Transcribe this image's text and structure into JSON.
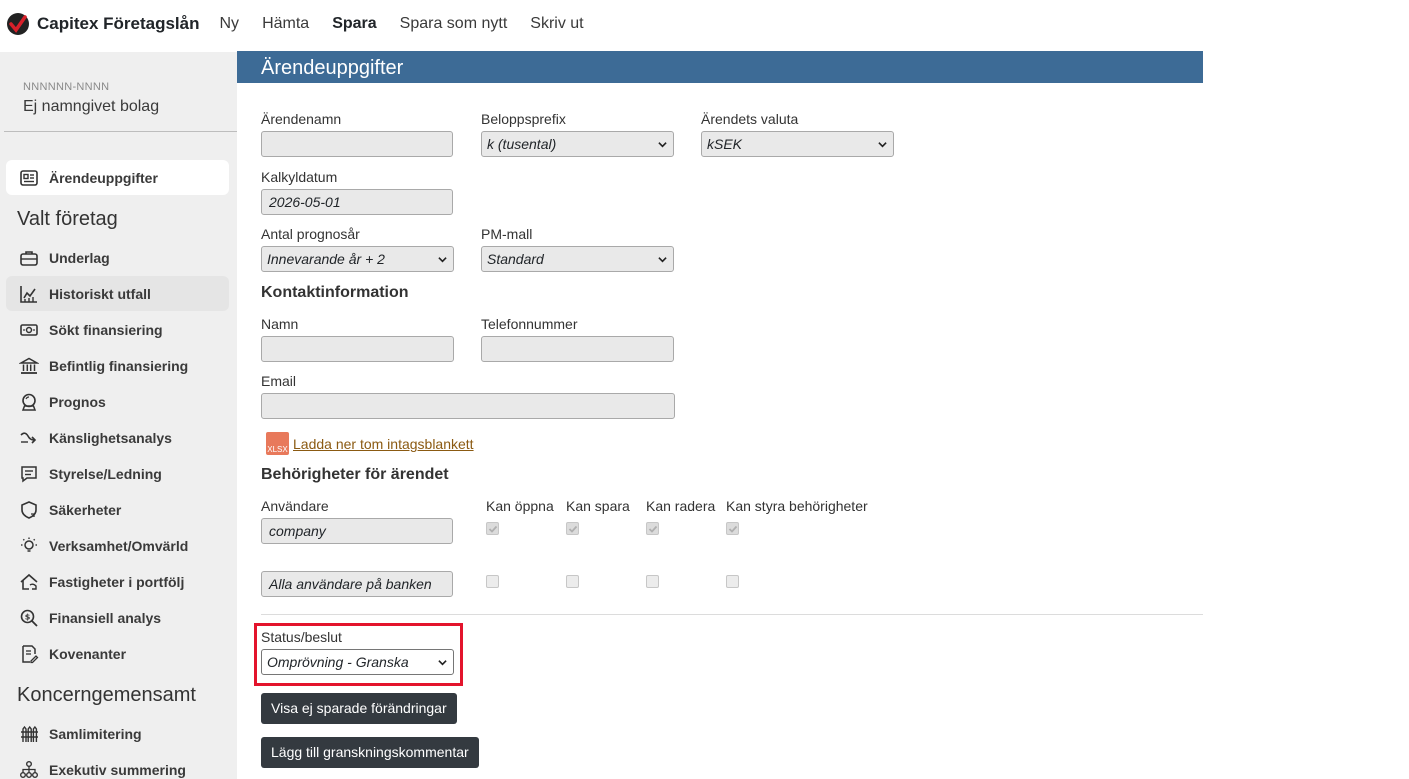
{
  "app": {
    "brand": "Capitex Företagslån",
    "nav": [
      {
        "label": "Ny",
        "bold": false
      },
      {
        "label": "Hämta",
        "bold": false
      },
      {
        "label": "Spara",
        "bold": true
      },
      {
        "label": "Spara som nytt",
        "bold": false
      },
      {
        "label": "Skriv ut",
        "bold": false
      }
    ]
  },
  "sidebar": {
    "org_nr": "NNNNNN-NNNN",
    "company_name": "Ej namngivet bolag",
    "top_item": {
      "label": "Ärendeuppgifter",
      "icon": "id-card-icon",
      "active": true
    },
    "section_valt": "Valt företag",
    "items": [
      {
        "label": "Underlag",
        "icon": "briefcase-icon"
      },
      {
        "label": "Historiskt utfall",
        "icon": "chart-icon"
      },
      {
        "label": "Sökt finansiering",
        "icon": "cash-icon"
      },
      {
        "label": "Befintlig finansiering",
        "icon": "bank-icon"
      },
      {
        "label": "Prognos",
        "icon": "crystal-ball-icon"
      },
      {
        "label": "Känslighetsanalys",
        "icon": "arrow-curve-icon"
      },
      {
        "label": "Styrelse/Ledning",
        "icon": "chat-list-icon"
      },
      {
        "label": "Säkerheter",
        "icon": "shield-icon"
      },
      {
        "label": "Verksamhet/Omvärld",
        "icon": "lightbulb-icon"
      },
      {
        "label": "Fastigheter i portfölj",
        "icon": "house-icon"
      },
      {
        "label": "Finansiell analys",
        "icon": "search-dollar-icon"
      },
      {
        "label": "Kovenanter",
        "icon": "document-edit-icon"
      }
    ],
    "section_koncern": "Koncerngemensamt",
    "koncern_items": [
      {
        "label": "Samlimitering",
        "icon": "fence-icon"
      },
      {
        "label": "Exekutiv summering",
        "icon": "hierarchy-icon"
      }
    ]
  },
  "main": {
    "title": "Ärendeuppgifter",
    "fields": {
      "arendenamn_label": "Ärendenamn",
      "arendenamn_value": "",
      "beloppsprefix_label": "Beloppsprefix",
      "beloppsprefix_value": "k (tusental)",
      "valuta_label": "Ärendets valuta",
      "valuta_value": "kSEK",
      "kalkyldatum_label": "Kalkyldatum",
      "kalkyldatum_value": "2026-05-01",
      "prognosar_label": "Antal prognosår",
      "prognosar_value": "Innevarande år + 2",
      "pmmall_label": "PM-mall",
      "pmmall_value": "Standard"
    },
    "contact": {
      "title": "Kontaktinformation",
      "namn_label": "Namn",
      "namn_value": "",
      "telefon_label": "Telefonnummer",
      "telefon_value": "",
      "email_label": "Email",
      "email_value": ""
    },
    "download": {
      "icon_text": "XLSX",
      "link": "Ladda ner tom intagsblankett"
    },
    "permissions": {
      "title": "Behörigheter för ärendet",
      "headers": [
        "Användare",
        "Kan öppna",
        "Kan spara",
        "Kan radera",
        "Kan styra behörigheter"
      ],
      "rows": [
        {
          "user": "company",
          "checks": [
            true,
            true,
            true,
            true
          ]
        },
        {
          "user": "Alla användare på banken",
          "checks": [
            false,
            false,
            false,
            false
          ]
        }
      ]
    },
    "status": {
      "label": "Status/beslut",
      "value": "Omprövning - Granska"
    },
    "buttons": {
      "unsaved": "Visa ej sparade förändringar",
      "add_comment": "Lägg till granskningskommentar"
    }
  },
  "colors": {
    "header_bg": "#3d6b96",
    "sidebar_bg": "#efefef",
    "button_bg": "#343a40",
    "highlight": "#e3142c",
    "link": "#8b5a12"
  }
}
